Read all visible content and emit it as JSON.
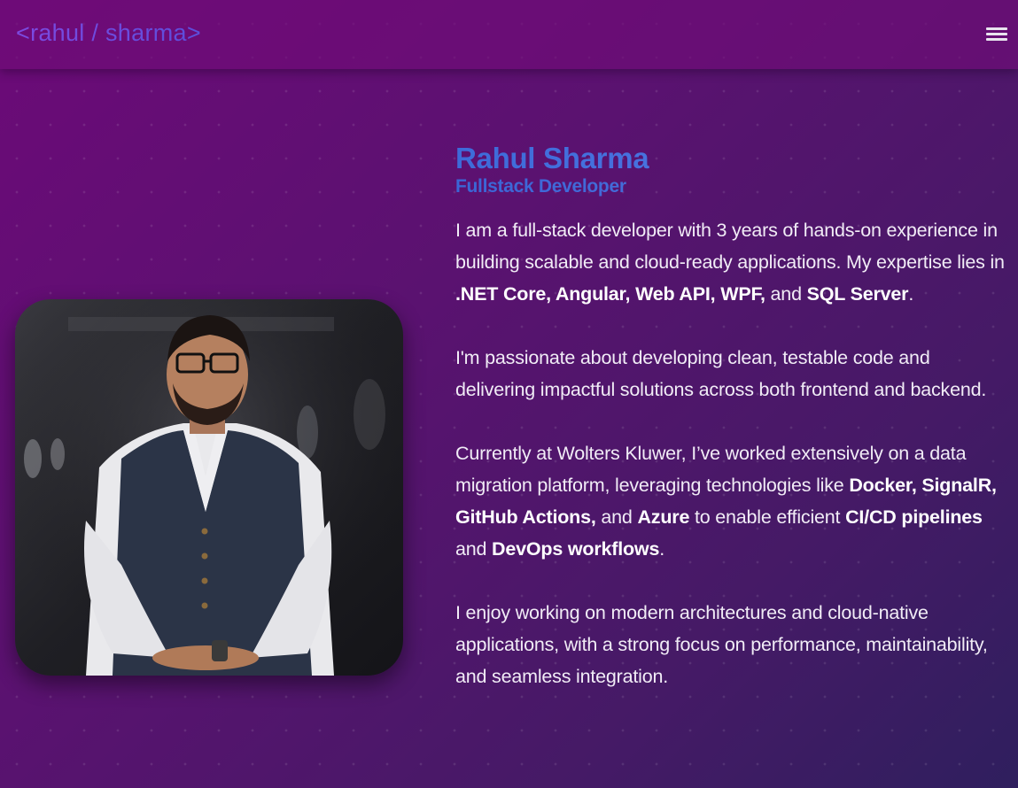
{
  "nav": {
    "brand": "<rahul / sharma>",
    "menu_icon": "hamburger-menu-icon"
  },
  "profile": {
    "name": "Rahul Sharma",
    "role": "Fullstack Developer",
    "photo_icon": "profile-photo"
  },
  "about": {
    "p1": {
      "t1": "I am a full-stack developer with 3 years of hands-on experience in building scalable and cloud-ready applications. My expertise lies in ",
      "b1": ".NET Core, Angular, Web API, WPF,",
      "t2": " and ",
      "b2": "SQL Server",
      "t3": "."
    },
    "p2": "I'm passionate about developing clean, testable code and delivering impactful solutions across both frontend and backend.",
    "p3": {
      "t1": "Currently at Wolters Kluwer, I’ve worked extensively on a data migration platform, leveraging technologies like ",
      "b1": "Docker, SignalR, GitHub Actions,",
      "t2": " and ",
      "b2": "Azure",
      "t3": " to enable efficient ",
      "b3": "CI/CD pipelines",
      "t4": " and ",
      "b4": "DevOps workflows",
      "t5": "."
    },
    "p4": "I enjoy working on modern architectures and cloud-native applications, with a strong focus on performance, maintainability, and seamless integration."
  },
  "colors": {
    "background_start": "#6c0a78",
    "background_end": "#2f1f5e",
    "accent_blue": "#4a72e0",
    "brand_purple": "#6f45d8"
  }
}
